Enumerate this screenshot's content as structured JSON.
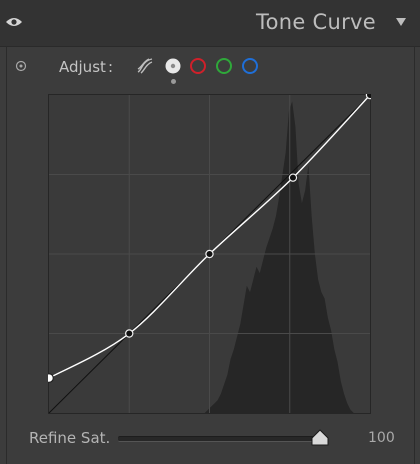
{
  "panel": {
    "title": "Tone Curve",
    "eye_icon": "eye-icon",
    "collapse_icon": "triangle-down-icon"
  },
  "adjust": {
    "label": "Adjust",
    "colon": ":",
    "target_icon": "target-adjust-icon",
    "channels": [
      {
        "name": "parametric",
        "icon": "parametric-curve-icon",
        "color": "#bdbdbd"
      },
      {
        "name": "point",
        "icon": "point-curve-icon",
        "color": "#e6e6e6",
        "selected": true
      },
      {
        "name": "red",
        "icon": "red-channel-icon",
        "color": "#d0202a"
      },
      {
        "name": "green",
        "icon": "green-channel-icon",
        "color": "#2fa83a"
      },
      {
        "name": "blue",
        "icon": "blue-channel-icon",
        "color": "#1f6fd8"
      }
    ]
  },
  "curve": {
    "grid_lines": 4,
    "points": [
      {
        "in": 0.0,
        "out": 0.11
      },
      {
        "in": 0.25,
        "out": 0.25
      },
      {
        "in": 0.5,
        "out": 0.5
      },
      {
        "in": 0.76,
        "out": 0.74
      },
      {
        "in": 1.0,
        "out": 1.0
      }
    ],
    "histogram": [
      0,
      0,
      0,
      0,
      0,
      0,
      0,
      0,
      0,
      0,
      0,
      0,
      0,
      0,
      0,
      0,
      0,
      0,
      0,
      0,
      0,
      0,
      0,
      0,
      0,
      0,
      0,
      0,
      0,
      0,
      0,
      0,
      0,
      0,
      0,
      0,
      0,
      0,
      0,
      0,
      0,
      0,
      0,
      0,
      0,
      0,
      0,
      0,
      0,
      0.01,
      0.02,
      0.03,
      0.04,
      0.06,
      0.09,
      0.12,
      0.17,
      0.2,
      0.24,
      0.28,
      0.34,
      0.4,
      0.38,
      0.42,
      0.46,
      0.44,
      0.48,
      0.52,
      0.55,
      0.58,
      0.62,
      0.68,
      0.75,
      0.82,
      0.95,
      0.98,
      0.9,
      0.72,
      0.66,
      0.7,
      0.78,
      0.62,
      0.5,
      0.42,
      0.38,
      0.36,
      0.3,
      0.26,
      0.2,
      0.16,
      0.1,
      0.06,
      0.03,
      0.01,
      0,
      0,
      0,
      0,
      0,
      0
    ]
  },
  "refine": {
    "label": "Refine Sat.",
    "value": "100",
    "level": 1.0
  }
}
